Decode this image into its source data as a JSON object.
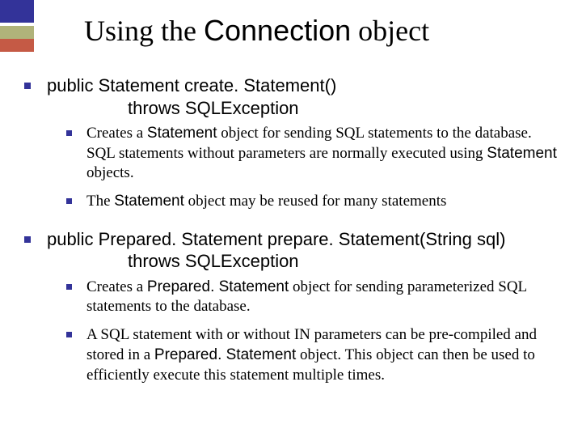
{
  "title": {
    "prefix": "Using the ",
    "conn": "Connection",
    "suffix": " object"
  },
  "items": [
    {
      "heading_line1": "public Statement create. Statement()",
      "heading_line2": "throws SQLException",
      "subs": [
        {
          "pre": "Creates a ",
          "kw1": "Statement",
          "mid1": " object for sending SQL statements to the database. SQL statements without parameters are normally executed using ",
          "kw2": "Statement",
          "post": " objects."
        },
        {
          "pre": "The ",
          "kw1": "Statement",
          "mid1": " object may be reused for many statements",
          "kw2": "",
          "post": ""
        }
      ]
    },
    {
      "heading_line1": "public Prepared. Statement prepare. Statement(String sql)",
      "heading_line2": "throws SQLException",
      "subs": [
        {
          "pre": "Creates a ",
          "kw1": "Prepared. Statement",
          "mid1": " object for sending parameterized SQL statements to the database.",
          "kw2": "",
          "post": ""
        },
        {
          "pre": "A SQL statement with or without IN parameters can be pre-compiled and stored in a ",
          "kw1": "Prepared. Statement",
          "mid1": " object. This object can then be used to efficiently execute this statement multiple times.",
          "kw2": "",
          "post": ""
        }
      ]
    }
  ]
}
